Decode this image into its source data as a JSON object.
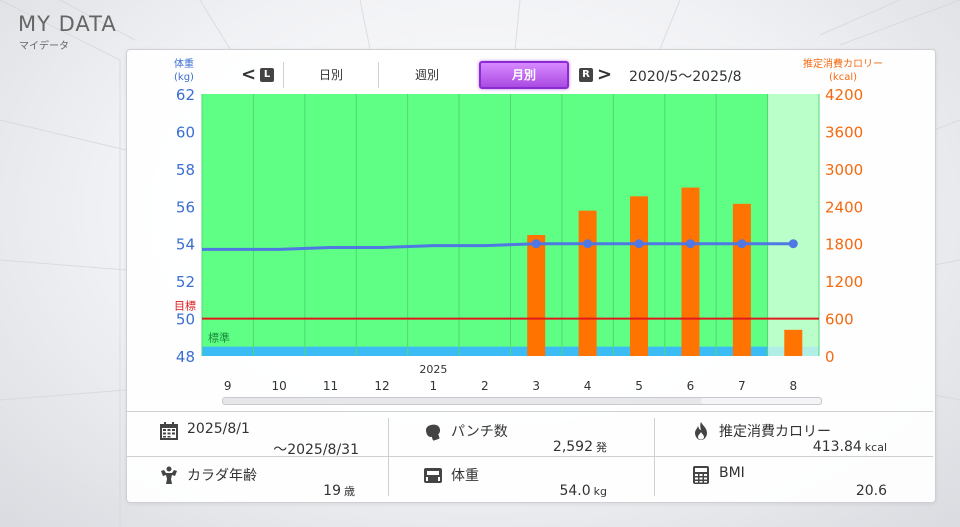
{
  "app": {
    "title": "MY DATA",
    "subtitle": "マイデータ"
  },
  "nav": {
    "prev_arrow": "<",
    "prev_key": "L",
    "next_key": "R",
    "next_arrow": ">",
    "tabs": [
      {
        "label": "日別",
        "selected": false
      },
      {
        "label": "週別",
        "selected": false
      },
      {
        "label": "月別",
        "selected": true
      }
    ],
    "date_range": "2020/5〜2025/8"
  },
  "axes": {
    "left_title": "体重",
    "left_unit": "(kg)",
    "right_title": "推定消費カロリー",
    "right_unit": "(kcal)"
  },
  "chart_data": {
    "type": "bar",
    "categories": [
      "9",
      "10",
      "11",
      "12",
      "1",
      "2",
      "3",
      "4",
      "5",
      "6",
      "7",
      "8"
    ],
    "year_label": "2025",
    "year_label_index": 4,
    "calorie_series": {
      "axis": "right",
      "color": "#ff7300",
      "values": [
        null,
        null,
        null,
        null,
        null,
        null,
        1940,
        2330,
        2560,
        2700,
        2440,
        420
      ]
    },
    "weight_series": {
      "axis": "left",
      "color": "#4f78e2",
      "values": [
        53.7,
        53.7,
        53.8,
        53.8,
        53.9,
        53.9,
        54.0,
        54.0,
        54.0,
        54.0,
        54.0,
        54.0
      ],
      "marked_from_index": 6
    },
    "left_axis": {
      "ticks": [
        "62",
        "60",
        "58",
        "56",
        "54",
        "52",
        "50",
        "48"
      ],
      "range": [
        48,
        62
      ]
    },
    "right_axis": {
      "ticks": [
        "4200",
        "3600",
        "3000",
        "2400",
        "1800",
        "1200",
        "600",
        "0"
      ],
      "range": [
        0,
        4200
      ]
    },
    "goal": {
      "label": "目標",
      "value": 50,
      "color": "#e01a1a"
    },
    "normal_band": {
      "label": "標準",
      "color": "#5fff86"
    },
    "low_band_color": "#3cbcf5",
    "current_period_index": 11
  },
  "stats": {
    "period_start": "2025/8/1",
    "period_end": "〜2025/8/31",
    "punches_label": "パンチ数",
    "punches_value": "2,592",
    "punches_unit": "発",
    "calories_label": "推定消費カロリー",
    "calories_value": "413.84",
    "calories_unit": "kcal",
    "body_age_label": "カラダ年齢",
    "body_age_value": "19",
    "body_age_unit": "歳",
    "weight_label": "体重",
    "weight_value": "54.0",
    "weight_unit": "kg",
    "bmi_label": "BMI",
    "bmi_value": "20.6"
  }
}
